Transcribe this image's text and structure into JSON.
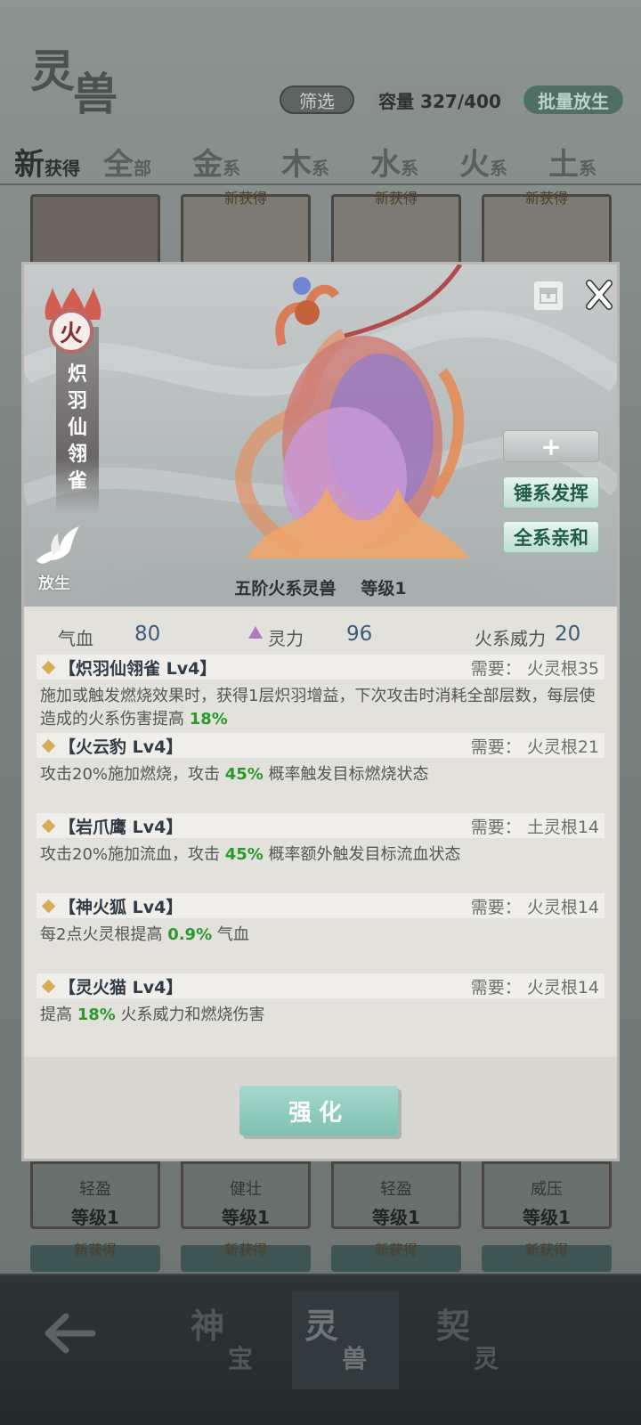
{
  "screen": {
    "title_char1": "灵",
    "title_char2": "兽",
    "filter_label": "筛选",
    "capacity_label": "容量 327/400",
    "batch_release_label": "批量放生"
  },
  "tabs": [
    {
      "big": "新",
      "small": "获得"
    },
    {
      "big": "全",
      "small": "部"
    },
    {
      "big": "金",
      "small": "系"
    },
    {
      "big": "木",
      "small": "系"
    },
    {
      "big": "水",
      "small": "系"
    },
    {
      "big": "火",
      "small": "系"
    },
    {
      "big": "土",
      "small": "系"
    }
  ],
  "grid": {
    "new_tag": "新获得",
    "row2": [
      {
        "trait": "轻盈",
        "level": "等级1"
      },
      {
        "trait": "健壮",
        "level": "等级1"
      },
      {
        "trait": "轻盈",
        "level": "等级1"
      },
      {
        "trait": "威压",
        "level": "等级1"
      }
    ]
  },
  "bottom_nav": {
    "items": [
      {
        "c1": "神",
        "c2": "宝"
      },
      {
        "c1": "灵",
        "c2": "兽"
      },
      {
        "c1": "契",
        "c2": "灵"
      }
    ]
  },
  "modal": {
    "element": "火",
    "beast_name": "炽羽仙翎雀",
    "release_label": "放生",
    "plus_label": "+",
    "btn_hammer": "锤系发挥",
    "btn_affinity": "全系亲和",
    "rank": "五阶火系灵兽",
    "level": "等级1",
    "stats": {
      "hp_label": "气血",
      "hp_value": "80",
      "sp_label": "灵力",
      "sp_value": "96",
      "fire_label": "火系威力",
      "fire_value": "20"
    },
    "skills": [
      {
        "title": "【炽羽仙翎雀 Lv4】",
        "req": "需要： 火灵根35",
        "desc_pre": "施加或触发燃烧效果时，获得1层炽羽增益，下次攻击时消耗全部层数，每层使造成的火系伤害提高 ",
        "desc_hl": "18%",
        "desc_post": ""
      },
      {
        "title": "【火云豹 Lv4】",
        "req": "需要： 火灵根21",
        "desc_pre": "攻击20%施加燃烧，攻击 ",
        "desc_hl": "45%",
        "desc_post": " 概率触发目标燃烧状态"
      },
      {
        "title": "【岩爪鹰 Lv4】",
        "req": "需要： 土灵根14",
        "desc_pre": "攻击20%施加流血，攻击 ",
        "desc_hl": "45%",
        "desc_post": " 概率额外触发目标流血状态"
      },
      {
        "title": "【神火狐 Lv4】",
        "req": "需要： 火灵根14",
        "desc_pre": "每2点火灵根提高 ",
        "desc_hl": "0.9%",
        "desc_post": " 气血"
      },
      {
        "title": "【灵火猫 Lv4】",
        "req": "需要： 火灵根14",
        "desc_pre": "提高 ",
        "desc_hl": "18%",
        "desc_post": " 火系威力和燃烧伤害"
      }
    ],
    "enhance_label": "强化"
  },
  "colors": {
    "accent_green": "#2a9a2a",
    "button_teal": "#7cc1b1",
    "fire_red": "#8b2e2e"
  }
}
